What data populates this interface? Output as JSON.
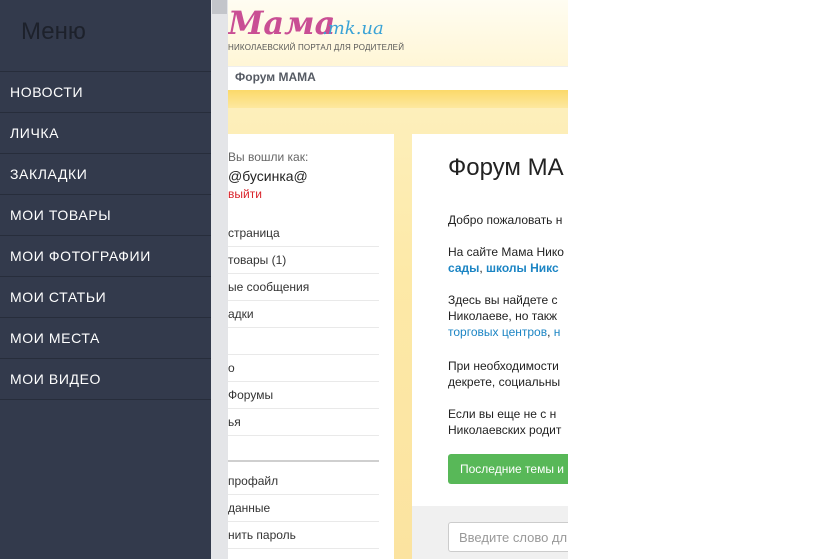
{
  "menu": {
    "title": "Меню",
    "items": [
      {
        "label": "НОВОСТИ"
      },
      {
        "label": "ЛИЧКА"
      },
      {
        "label": "ЗАКЛАДКИ"
      },
      {
        "label": "МОИ ТОВАРЫ"
      },
      {
        "label": "МОИ ФОТОГРАФИИ"
      },
      {
        "label": "МОИ СТАТЬИ"
      },
      {
        "label": "МОИ МЕСТА"
      },
      {
        "label": "МОИ ВИДЕО"
      }
    ]
  },
  "header": {
    "logo": "Мама",
    "logo_domain": ".mk.ua",
    "tagline": "НИКОЛАЕВСКИЙ ПОРТАЛ ДЛЯ РОДИТЕЛЕЙ",
    "breadcrumb": "Форум МАМА"
  },
  "user_panel": {
    "logged_in_as": "Вы вошли как:",
    "username": "@бусинка@",
    "logout": "выйти",
    "nav": [
      {
        "label": "страница"
      },
      {
        "label": "товары",
        "count": "(1)"
      },
      {
        "label": "ые сообщения"
      },
      {
        "label": "адки"
      },
      {
        "label": ""
      },
      {
        "label": "о"
      },
      {
        "label": "Форумы"
      },
      {
        "label": "ья"
      },
      {
        "label": ""
      }
    ],
    "profile_nav": [
      {
        "label": "профайл"
      },
      {
        "label": "данные"
      },
      {
        "label": "нить пароль"
      }
    ]
  },
  "main": {
    "title": "Форум МА",
    "welcome": "Добро пожаловать н",
    "para2_line1": "На сайте Мама Нико",
    "para2_link1": "сады",
    "para2_sep": ", ",
    "para2_link2": "школы Никс",
    "para3_line1": "Здесь вы найдете с",
    "para3_line2": "Николаеве, но такж",
    "para3_link1": "торговых центров",
    "para3_sep": ", ",
    "para3_link2": "н",
    "para4_line1": "При необходимости",
    "para4_line2": "декрете, социальны",
    "para5_line1": "Если вы еще не с н",
    "para5_line2": "Николаевских родит",
    "latest_button": "Последние темы и",
    "search_placeholder": "Введите слово дл"
  }
}
